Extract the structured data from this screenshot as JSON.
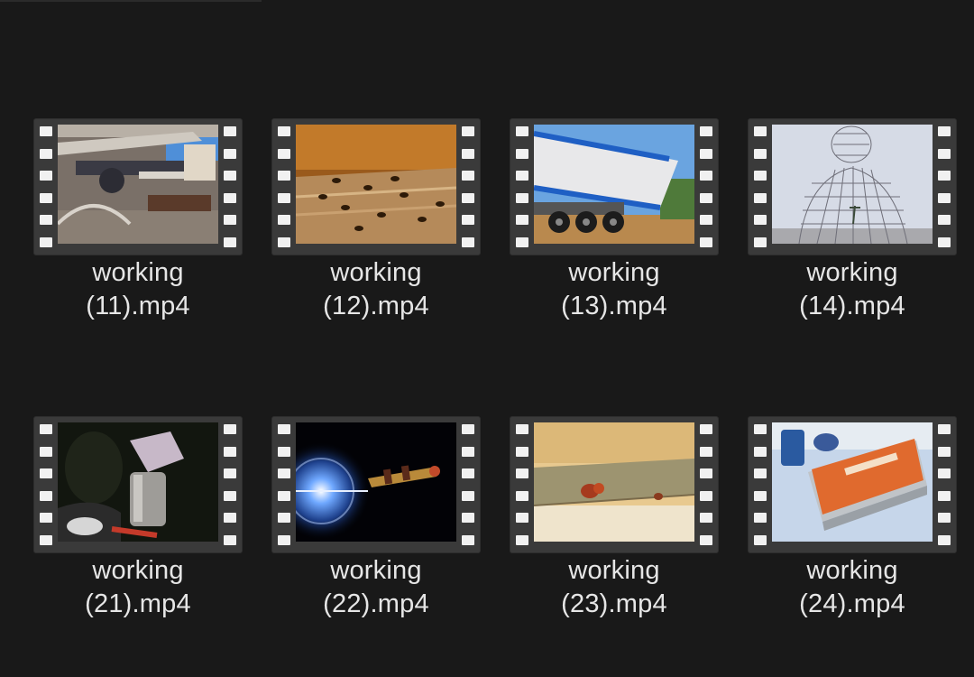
{
  "files": [
    {
      "line1": "working",
      "line2": "(11).mp4",
      "thumb": "pipes-icon"
    },
    {
      "line1": "working",
      "line2": "(12).mp4",
      "thumb": "bees-icon"
    },
    {
      "line1": "working",
      "line2": "(13).mp4",
      "thumb": "truck-icon"
    },
    {
      "line1": "working",
      "line2": "(14).mp4",
      "thumb": "wire-sculpture-icon"
    },
    {
      "line1": "working",
      "line2": "(21).mp4",
      "thumb": "welder-icon"
    },
    {
      "line1": "working",
      "line2": "(22).mp4",
      "thumb": "light-flare-icon"
    },
    {
      "line1": "working",
      "line2": "(23).mp4",
      "thumb": "bug-on-wall-icon"
    },
    {
      "line1": "working",
      "line2": "(24).mp4",
      "thumb": "tin-box-icon"
    }
  ]
}
